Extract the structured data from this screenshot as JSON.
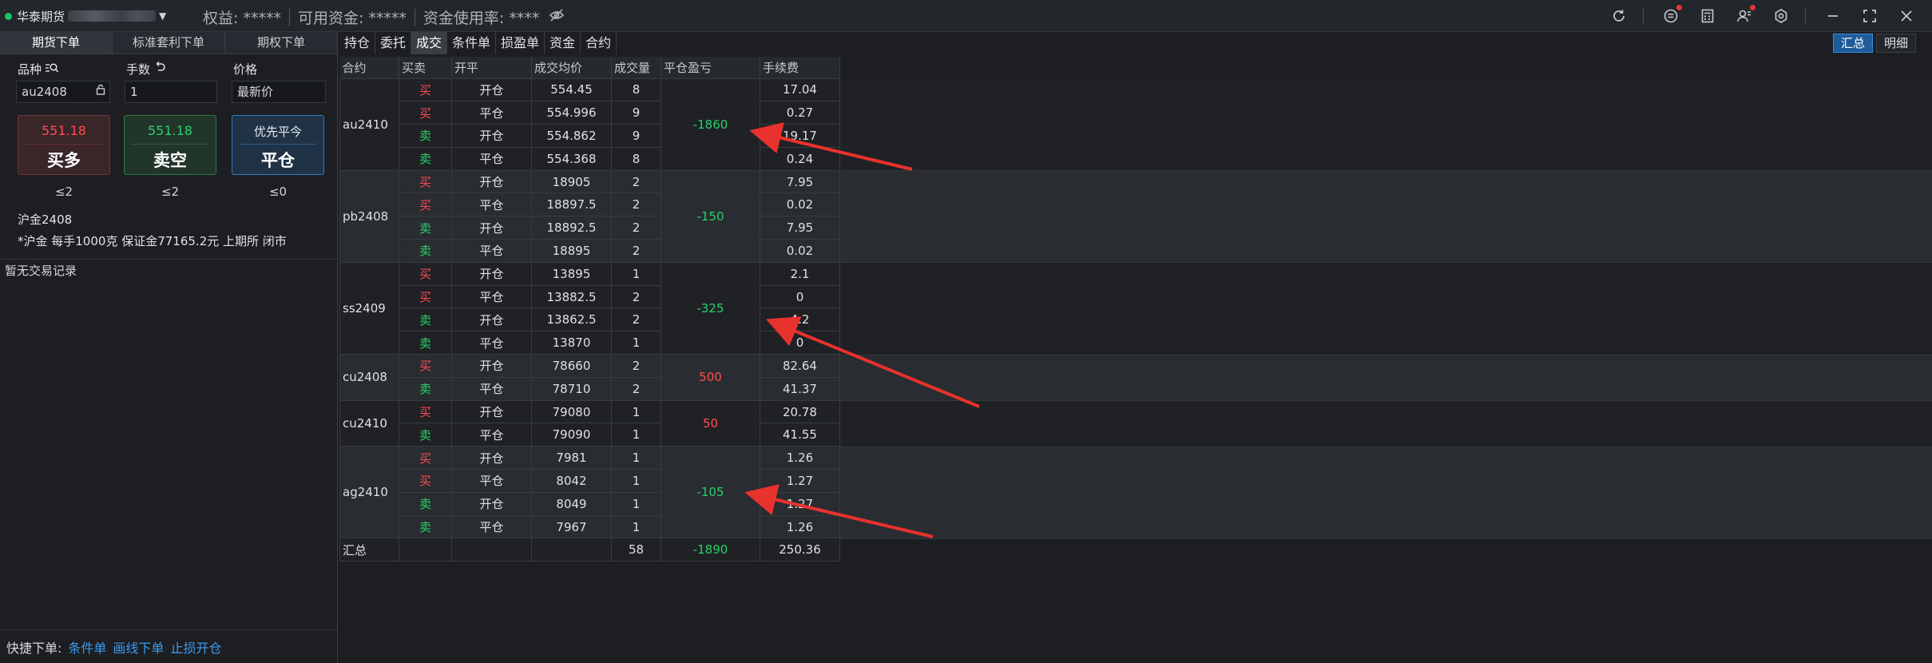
{
  "topbar": {
    "account_name": "华泰期货",
    "equity": "权益: *****",
    "available": "可用资金: *****",
    "usage": "资金使用率: ****"
  },
  "left": {
    "tabs": [
      "期货下单",
      "标准套利下单",
      "期权下单"
    ],
    "labels": {
      "symbol": "品种",
      "qty": "手数",
      "price": "价格"
    },
    "fields": {
      "symbol": "au2408",
      "qty": "1",
      "price": "最新价"
    },
    "buy": {
      "price": "551.18",
      "label": "买多",
      "limit": "≤2"
    },
    "sell": {
      "price": "551.18",
      "label": "卖空",
      "limit": "≤2"
    },
    "close": {
      "top": "优先平今",
      "label": "平仓",
      "limit": "≤0"
    },
    "inst_name": "沪金2408",
    "inst_desc": "*沪金 每手1000克 保证金77165.2元 上期所 闭市",
    "no_records": "暂无交易记录",
    "quick_label": "快捷下单:",
    "quick_links": [
      "条件单",
      "画线下单",
      "止损开仓"
    ]
  },
  "right": {
    "tabs": [
      "持仓",
      "委托",
      "成交",
      "条件单",
      "损盈单",
      "资金",
      "合约"
    ],
    "buttons": {
      "summary": "汇总",
      "detail": "明细"
    },
    "headers": [
      "合约",
      "买卖",
      "开平",
      "成交均价",
      "成交量",
      "平仓盈亏",
      "手续费"
    ]
  },
  "trades": [
    {
      "contract": "au2410",
      "pnl": "-1860",
      "pnl_sign": "neg",
      "rows": [
        {
          "side": "买",
          "oc": "开仓",
          "price": "554.45",
          "vol": "8",
          "fee": "17.04"
        },
        {
          "side": "买",
          "oc": "平仓",
          "price": "554.996",
          "vol": "9",
          "fee": "0.27"
        },
        {
          "side": "卖",
          "oc": "开仓",
          "price": "554.862",
          "vol": "9",
          "fee": "19.17"
        },
        {
          "side": "卖",
          "oc": "平仓",
          "price": "554.368",
          "vol": "8",
          "fee": "0.24"
        }
      ]
    },
    {
      "contract": "pb2408",
      "pnl": "-150",
      "pnl_sign": "neg",
      "rows": [
        {
          "side": "买",
          "oc": "开仓",
          "price": "18905",
          "vol": "2",
          "fee": "7.95"
        },
        {
          "side": "买",
          "oc": "平仓",
          "price": "18897.5",
          "vol": "2",
          "fee": "0.02"
        },
        {
          "side": "卖",
          "oc": "开仓",
          "price": "18892.5",
          "vol": "2",
          "fee": "7.95"
        },
        {
          "side": "卖",
          "oc": "平仓",
          "price": "18895",
          "vol": "2",
          "fee": "0.02"
        }
      ]
    },
    {
      "contract": "ss2409",
      "pnl": "-325",
      "pnl_sign": "neg",
      "rows": [
        {
          "side": "买",
          "oc": "开仓",
          "price": "13895",
          "vol": "1",
          "fee": "2.1"
        },
        {
          "side": "买",
          "oc": "平仓",
          "price": "13882.5",
          "vol": "2",
          "fee": "0"
        },
        {
          "side": "卖",
          "oc": "开仓",
          "price": "13862.5",
          "vol": "2",
          "fee": "4.2"
        },
        {
          "side": "卖",
          "oc": "平仓",
          "price": "13870",
          "vol": "1",
          "fee": "0"
        }
      ]
    },
    {
      "contract": "cu2408",
      "pnl": "500",
      "pnl_sign": "pos",
      "rows": [
        {
          "side": "买",
          "oc": "开仓",
          "price": "78660",
          "vol": "2",
          "fee": "82.64"
        },
        {
          "side": "卖",
          "oc": "平仓",
          "price": "78710",
          "vol": "2",
          "fee": "41.37"
        }
      ]
    },
    {
      "contract": "cu2410",
      "pnl": "50",
      "pnl_sign": "pos",
      "rows": [
        {
          "side": "买",
          "oc": "开仓",
          "price": "79080",
          "vol": "1",
          "fee": "20.78"
        },
        {
          "side": "卖",
          "oc": "平仓",
          "price": "79090",
          "vol": "1",
          "fee": "41.55"
        }
      ]
    },
    {
      "contract": "ag2410",
      "pnl": "-105",
      "pnl_sign": "neg",
      "rows": [
        {
          "side": "买",
          "oc": "开仓",
          "price": "7981",
          "vol": "1",
          "fee": "1.26"
        },
        {
          "side": "买",
          "oc": "平仓",
          "price": "8042",
          "vol": "1",
          "fee": "1.27"
        },
        {
          "side": "卖",
          "oc": "开仓",
          "price": "8049",
          "vol": "1",
          "fee": "1.27"
        },
        {
          "side": "卖",
          "oc": "平仓",
          "price": "7967",
          "vol": "1",
          "fee": "1.26"
        }
      ]
    }
  ],
  "total": {
    "label": "汇总",
    "vol": "58",
    "pnl": "-1890",
    "fee": "250.36"
  }
}
